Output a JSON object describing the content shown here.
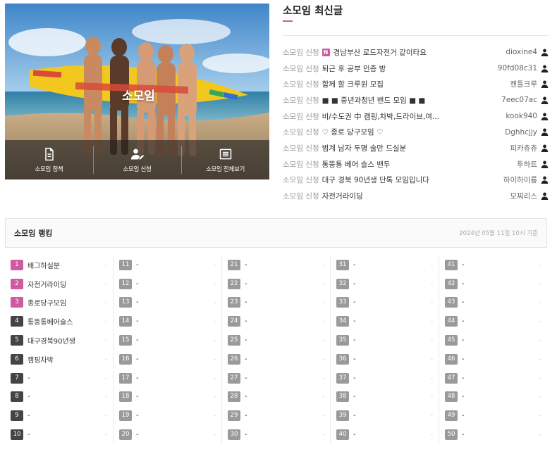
{
  "hero": {
    "logo_text": "소모임",
    "buttons": [
      {
        "label": "소모임 정책",
        "icon": "document-icon"
      },
      {
        "label": "소모임 신청",
        "icon": "user-edit-icon"
      },
      {
        "label": "소모임 전체보기",
        "icon": "list-icon"
      }
    ]
  },
  "latest": {
    "title": "소모임 최신글",
    "posts": [
      {
        "category": "소모임 신청",
        "badge": "N",
        "title": "경남부산 로드자전거 같이타요",
        "author": "dioxine4"
      },
      {
        "category": "소모임 신청",
        "badge": "",
        "title": "퇴근 후 공부 인증 방",
        "author": "90fd08c31"
      },
      {
        "category": "소모임 신청",
        "badge": "",
        "title": "함께 할 크루원 모집",
        "author": "젠틀크루"
      },
      {
        "category": "소모임 신청",
        "badge": "",
        "title": "■ ■ 중년과청년 밴드 모임 ■ ■",
        "author": "7eec07ac"
      },
      {
        "category": "소모임 신청",
        "badge": "",
        "title": "비/수도권 中 캠핑,차박,드라이브,여...",
        "author": "kook940"
      },
      {
        "category": "소모임 신청",
        "badge": "",
        "title": "♡ 종로 당구모임 ♡",
        "author": "Dghhcjjy"
      },
      {
        "category": "소모임 신청",
        "badge": "",
        "title": "범계 남자 두명 술만 드실분",
        "author": "피카츄츄"
      },
      {
        "category": "소모임 신청",
        "badge": "",
        "title": "통뚱통 베어 슬스 밴두",
        "author": "투하트"
      },
      {
        "category": "소모임 신청",
        "badge": "",
        "title": "대구 경북 90년생 단톡 모임입니다",
        "author": "하이하이룡"
      },
      {
        "category": "소모임 신청",
        "badge": "",
        "title": "자전거라이딩",
        "author": "모찌리스"
      }
    ]
  },
  "ranking": {
    "title": "소모임 랭킹",
    "date": "2024년 05월 11일 10시 기준",
    "items": [
      {
        "rank": "1",
        "name": "배그하실분",
        "value": "-"
      },
      {
        "rank": "2",
        "name": "자전거라이딩",
        "value": "-"
      },
      {
        "rank": "3",
        "name": "종로당구모임",
        "value": "-"
      },
      {
        "rank": "4",
        "name": "통뚱통베어슬스",
        "value": "-"
      },
      {
        "rank": "5",
        "name": "대구경북90년생",
        "value": "-"
      },
      {
        "rank": "6",
        "name": "캠핑차박",
        "value": "-"
      },
      {
        "rank": "7",
        "name": "-",
        "value": "-"
      },
      {
        "rank": "8",
        "name": "-",
        "value": "-"
      },
      {
        "rank": "9",
        "name": "-",
        "value": "-"
      },
      {
        "rank": "10",
        "name": "-",
        "value": "-"
      },
      {
        "rank": "11",
        "name": "-",
        "value": "-"
      },
      {
        "rank": "12",
        "name": "-",
        "value": "-"
      },
      {
        "rank": "13",
        "name": "-",
        "value": "-"
      },
      {
        "rank": "14",
        "name": "-",
        "value": "-"
      },
      {
        "rank": "15",
        "name": "-",
        "value": "-"
      },
      {
        "rank": "16",
        "name": "-",
        "value": "-"
      },
      {
        "rank": "17",
        "name": "-",
        "value": "-"
      },
      {
        "rank": "18",
        "name": "-",
        "value": "-"
      },
      {
        "rank": "19",
        "name": "-",
        "value": "-"
      },
      {
        "rank": "20",
        "name": "-",
        "value": "-"
      },
      {
        "rank": "21",
        "name": "-",
        "value": "-"
      },
      {
        "rank": "22",
        "name": "-",
        "value": "-"
      },
      {
        "rank": "23",
        "name": "-",
        "value": "-"
      },
      {
        "rank": "24",
        "name": "-",
        "value": "-"
      },
      {
        "rank": "25",
        "name": "-",
        "value": "-"
      },
      {
        "rank": "26",
        "name": "-",
        "value": "-"
      },
      {
        "rank": "27",
        "name": "-",
        "value": "-"
      },
      {
        "rank": "28",
        "name": "-",
        "value": "-"
      },
      {
        "rank": "29",
        "name": "-",
        "value": "-"
      },
      {
        "rank": "30",
        "name": "-",
        "value": "-"
      },
      {
        "rank": "31",
        "name": "-",
        "value": "-"
      },
      {
        "rank": "32",
        "name": "-",
        "value": "-"
      },
      {
        "rank": "33",
        "name": "-",
        "value": "-"
      },
      {
        "rank": "34",
        "name": "-",
        "value": "-"
      },
      {
        "rank": "35",
        "name": "-",
        "value": "-"
      },
      {
        "rank": "36",
        "name": "-",
        "value": "-"
      },
      {
        "rank": "37",
        "name": "-",
        "value": "-"
      },
      {
        "rank": "38",
        "name": "-",
        "value": "-"
      },
      {
        "rank": "39",
        "name": "-",
        "value": "-"
      },
      {
        "rank": "40",
        "name": "-",
        "value": "-"
      },
      {
        "rank": "41",
        "name": "-",
        "value": "-"
      },
      {
        "rank": "42",
        "name": "-",
        "value": "-"
      },
      {
        "rank": "43",
        "name": "-",
        "value": "-"
      },
      {
        "rank": "44",
        "name": "-",
        "value": "-"
      },
      {
        "rank": "45",
        "name": "-",
        "value": "-"
      },
      {
        "rank": "46",
        "name": "-",
        "value": "-"
      },
      {
        "rank": "47",
        "name": "-",
        "value": "-"
      },
      {
        "rank": "48",
        "name": "-",
        "value": "-"
      },
      {
        "rank": "49",
        "name": "-",
        "value": "-"
      },
      {
        "rank": "50",
        "name": "-",
        "value": "-"
      }
    ]
  },
  "colors": {
    "accent": "#d05aa0",
    "rank_top": "#d05aa0",
    "rank_mid": "#444444",
    "rank_rest": "#9a9a9a"
  }
}
